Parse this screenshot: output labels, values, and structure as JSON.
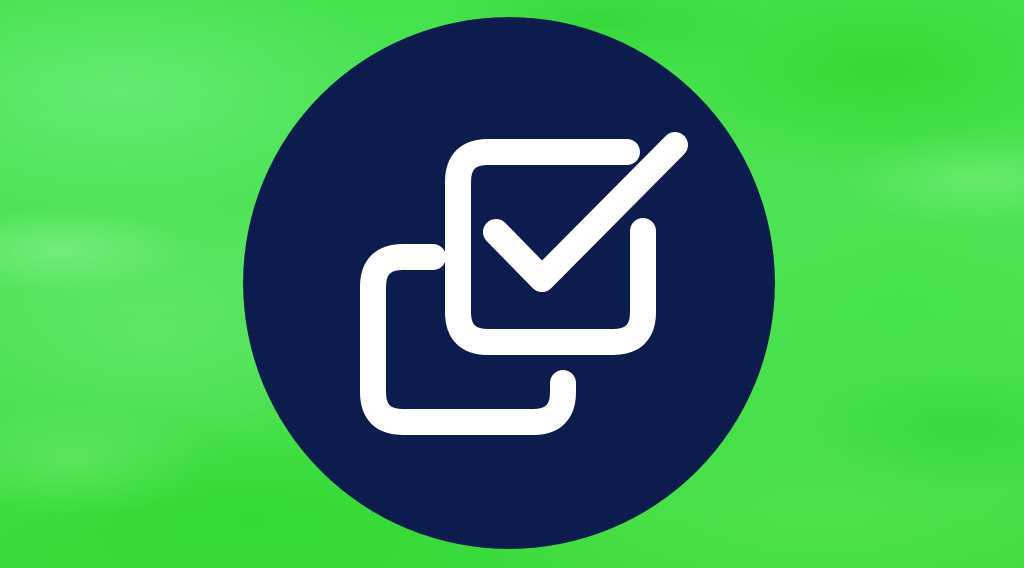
{
  "scene": {
    "background_color": "#44df4c",
    "badge_color": "#0b1c4d",
    "icon_color": "#ffffff",
    "icon": "double-checkbox-check-icon"
  }
}
